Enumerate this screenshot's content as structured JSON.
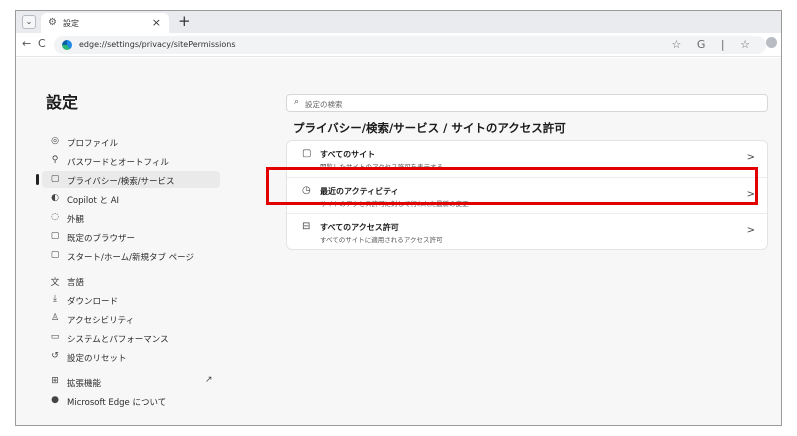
{
  "window": {
    "tab_dropdown": "⌄",
    "tab": {
      "icon": "gear-icon",
      "title": "設定",
      "close": "×"
    },
    "new_tab": "+"
  },
  "toolbar": {
    "back": "←",
    "reload": "C",
    "url": "edge://settings/privacy/sitePermissions",
    "icons": [
      "star-icon",
      "copilot-icon",
      "favorites-icon"
    ],
    "icons_text": "☆ G | ☆"
  },
  "sidebar": {
    "title": "設定",
    "items": [
      {
        "icon": "profile-icon",
        "glyph": "◎",
        "label": "プロファイル"
      },
      {
        "icon": "key-icon",
        "glyph": "⚲",
        "label": "パスワードとオートフィル"
      },
      {
        "icon": "lock-icon",
        "glyph": "▢",
        "label": "プライバシー/検索/サービス",
        "active": true
      },
      {
        "icon": "copilot-icon",
        "glyph": "◐",
        "label": "Copilot と AI"
      },
      {
        "icon": "appearance-icon",
        "glyph": "◌",
        "label": "外観"
      },
      {
        "icon": "browser-icon",
        "glyph": "▢",
        "label": "既定のブラウザー"
      },
      {
        "icon": "home-icon",
        "glyph": "▢",
        "label": "スタート/ホーム/新規タブ ページ"
      },
      {
        "icon": "language-icon",
        "glyph": "文",
        "label": "言語"
      },
      {
        "icon": "download-icon",
        "glyph": "⤓",
        "label": "ダウンロード"
      },
      {
        "icon": "accessibility-icon",
        "glyph": "♙",
        "label": "アクセシビリティ"
      },
      {
        "icon": "system-icon",
        "glyph": "▭",
        "label": "システムとパフォーマンス"
      },
      {
        "icon": "reset-icon",
        "glyph": "↺",
        "label": "設定のリセット"
      },
      {
        "icon": "extensions-icon",
        "glyph": "⊞",
        "label": "拡張機能",
        "ext": "↗"
      },
      {
        "icon": "edge-icon",
        "glyph": "●",
        "label": "Microsoft Edge について"
      }
    ]
  },
  "main": {
    "search_placeholder": "設定の検索",
    "page_title": "プライバシー/検索/サービス / サイトのアクセス許可",
    "rows": [
      {
        "icon": "window-icon",
        "glyph": "▢",
        "title": "すべてのサイト",
        "subtitle": "閲覧したサイトのアクセス許可を表示する",
        "chevron": ">"
      },
      {
        "icon": "clock-icon",
        "glyph": "◷",
        "title": "最近のアクティビティ",
        "subtitle": "サイトのアクセス許可に対して行われた最新の変更",
        "chevron": ">"
      },
      {
        "icon": "permissions-icon",
        "glyph": "⊟",
        "title": "すべてのアクセス許可",
        "subtitle": "すべてのサイトに適用されるアクセス許可",
        "chevron": ">"
      }
    ]
  },
  "colors": {
    "highlight": "#e30000",
    "active_bg": "#eaeaea"
  }
}
